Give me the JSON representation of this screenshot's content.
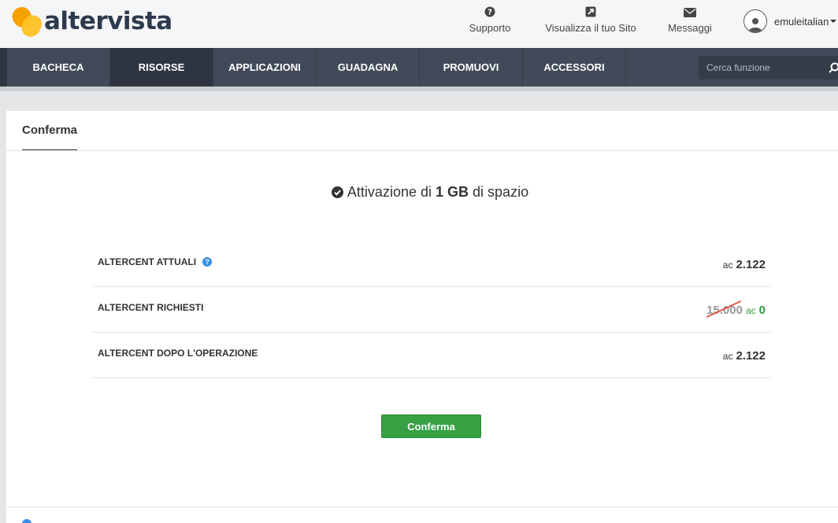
{
  "brand": {
    "name": "altervista"
  },
  "topbar": {
    "support_label": "Supporto",
    "site_label": "Visualizza il tuo Sito",
    "messages_label": "Messaggi",
    "username": "emuleitalian"
  },
  "nav": {
    "items": [
      {
        "label": "BACHECA"
      },
      {
        "label": "RISORSE"
      },
      {
        "label": "APPLICAZIONI"
      },
      {
        "label": "GUADAGNA"
      },
      {
        "label": "PROMUOVI"
      },
      {
        "label": "ACCESSORI"
      }
    ],
    "active_index": 1,
    "search_placeholder": "Cerca funzione"
  },
  "tab": {
    "label": "Conferma"
  },
  "heading": {
    "prefix": "Attivazione di",
    "amount": "1 GB",
    "suffix": "di spazio"
  },
  "rows": [
    {
      "label": "ALTERCENT ATTUALI",
      "unit": "ac",
      "value": "2.122"
    },
    {
      "label": "ALTERCENT RICHIESTI",
      "old_value": "15.000",
      "unit": "ac",
      "value": "0"
    },
    {
      "label": "ALTERCENT DOPO L'OPERAZIONE",
      "unit": "ac",
      "value": "2.122"
    }
  ],
  "confirm_button": "Conferma",
  "colors": {
    "nav_bg": "#414a58",
    "accent_green": "#37a043",
    "help_blue": "#3b8ee6",
    "strike_red": "#e05a47"
  }
}
